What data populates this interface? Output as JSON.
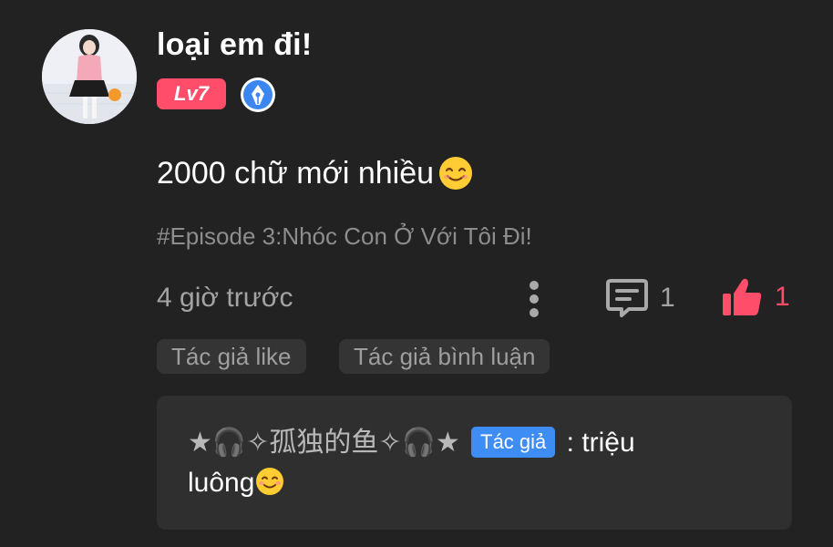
{
  "post": {
    "username": "loại em đi!",
    "level": "Lv7",
    "content": "2000 chữ mới nhiều",
    "topic": "#Episode 3:Nhóc Con Ở Với Tôi Đi!",
    "time": "4 giờ trước",
    "comment_count": "1",
    "like_count": "1",
    "content_emoji": "smiling-face-emoji"
  },
  "tags": {
    "author_liked": "Tác giả like",
    "author_replied": "Tác giả bình luận"
  },
  "reply": {
    "author_name": "★🎧✧孤独的鱼✧🎧★",
    "author_tag": "Tác giả",
    "separator": ":",
    "text_part1": "triệu",
    "text_part2": "luông",
    "text_emoji": "blushing-face-emoji"
  },
  "colors": {
    "background": "#222222",
    "accent_pink": "#ff4d6a",
    "author_blue": "#3d8df5",
    "muted_text": "#a3a3a3"
  }
}
